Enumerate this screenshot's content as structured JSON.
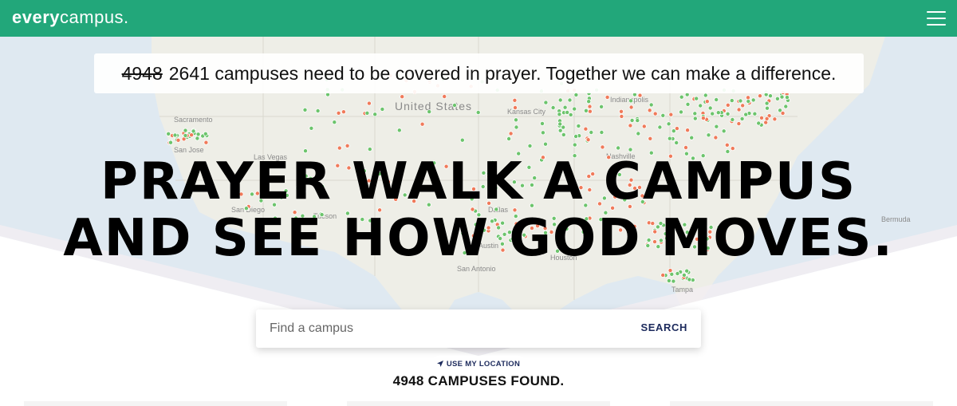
{
  "header": {
    "logo_part1": "every",
    "logo_part2": "campus.",
    "menu_icon": "hamburger-menu-icon",
    "bg_color": "#22a77a"
  },
  "banner": {
    "old_count": "4948",
    "text": "2641 campuses need to be covered in prayer. Together we can make a difference."
  },
  "hero": {
    "line1": "PRAYER WALK A CAMPUS",
    "line2": "AND SEE HOW GOD MOVES."
  },
  "map": {
    "labels": [
      "United States",
      "Kansas City",
      "Sacramento",
      "San Jose",
      "Las Vegas",
      "San Diego",
      "Tucson",
      "Dallas",
      "Austin",
      "San Antonio",
      "Houston",
      "Nashville",
      "Indianapolis",
      "Tampa",
      "Bermuda"
    ],
    "marker_colors": {
      "covered": "#6cc46c",
      "needed": "#f07a5a"
    }
  },
  "search": {
    "placeholder": "Find a campus",
    "button_label": "SEARCH"
  },
  "location": {
    "icon": "location-arrow-icon",
    "label": "USE MY LOCATION"
  },
  "results": {
    "found_label": "4948 CAMPUSES FOUND."
  }
}
